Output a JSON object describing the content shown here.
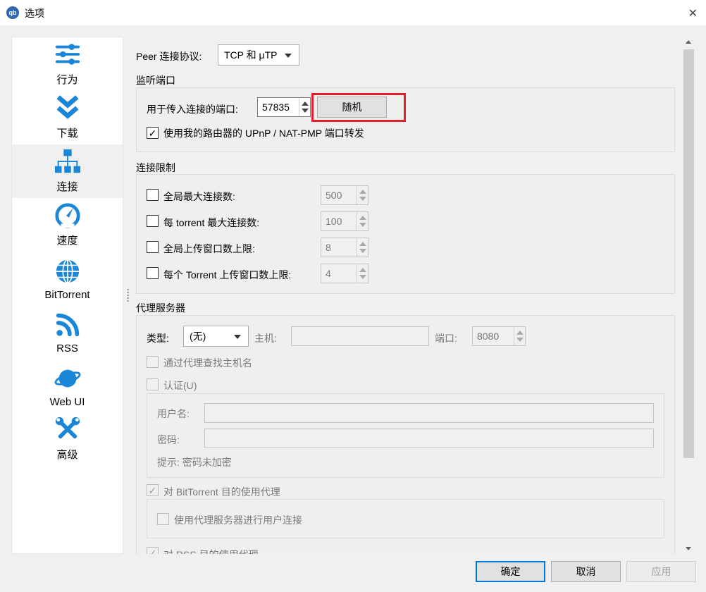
{
  "window": {
    "title": "选项",
    "app_icon_text": "qb"
  },
  "sidebar": {
    "items": [
      {
        "label": "行为"
      },
      {
        "label": "下载"
      },
      {
        "label": "连接"
      },
      {
        "label": "速度"
      },
      {
        "label": "BitTorrent"
      },
      {
        "label": "RSS"
      },
      {
        "label": "Web UI"
      },
      {
        "label": "高级"
      }
    ],
    "selected": "连接"
  },
  "peer": {
    "label": "Peer 连接协议:",
    "value": "TCP 和 μTP"
  },
  "listen": {
    "group_title": "监听端口",
    "port_label": "用于传入连接的端口:",
    "port_value": "57835",
    "random_button": "随机",
    "upnp_label": "使用我的路由器的 UPnP / NAT-PMP 端口转发",
    "upnp_checked": "✓"
  },
  "limits": {
    "group_title": "连接限制",
    "rows": [
      {
        "label": "全局最大连接数:",
        "value": "500"
      },
      {
        "label": "每 torrent 最大连接数:",
        "value": "100"
      },
      {
        "label": "全局上传窗口数上限:",
        "value": "8"
      },
      {
        "label": "每个 Torrent 上传窗口数上限:",
        "value": "4"
      }
    ]
  },
  "proxy": {
    "group_title": "代理服务器",
    "type_label": "类型:",
    "type_value": "(无)",
    "host_label": "主机:",
    "port_label": "端口:",
    "port_value": "8080",
    "lookup_label": "通过代理查找主机名",
    "auth_label": "认证(U)",
    "username_label": "用户名:",
    "password_label": "密码:",
    "hint": "提示: 密码未加密",
    "bittorrent_label": "对 BitTorrent 目的使用代理",
    "bittorrent_checked": "✓",
    "peer_conn_label": "使用代理服务器进行用户连接",
    "rss_label": "对 RSS 目的使用代理",
    "rss_checked": "✓"
  },
  "footer": {
    "ok": "确定",
    "cancel": "取消",
    "apply": "应用"
  },
  "colors": {
    "highlight": "#e0202a",
    "icon_blue": "#1a86d8",
    "sidebar_selected": "#f0f0f0"
  }
}
